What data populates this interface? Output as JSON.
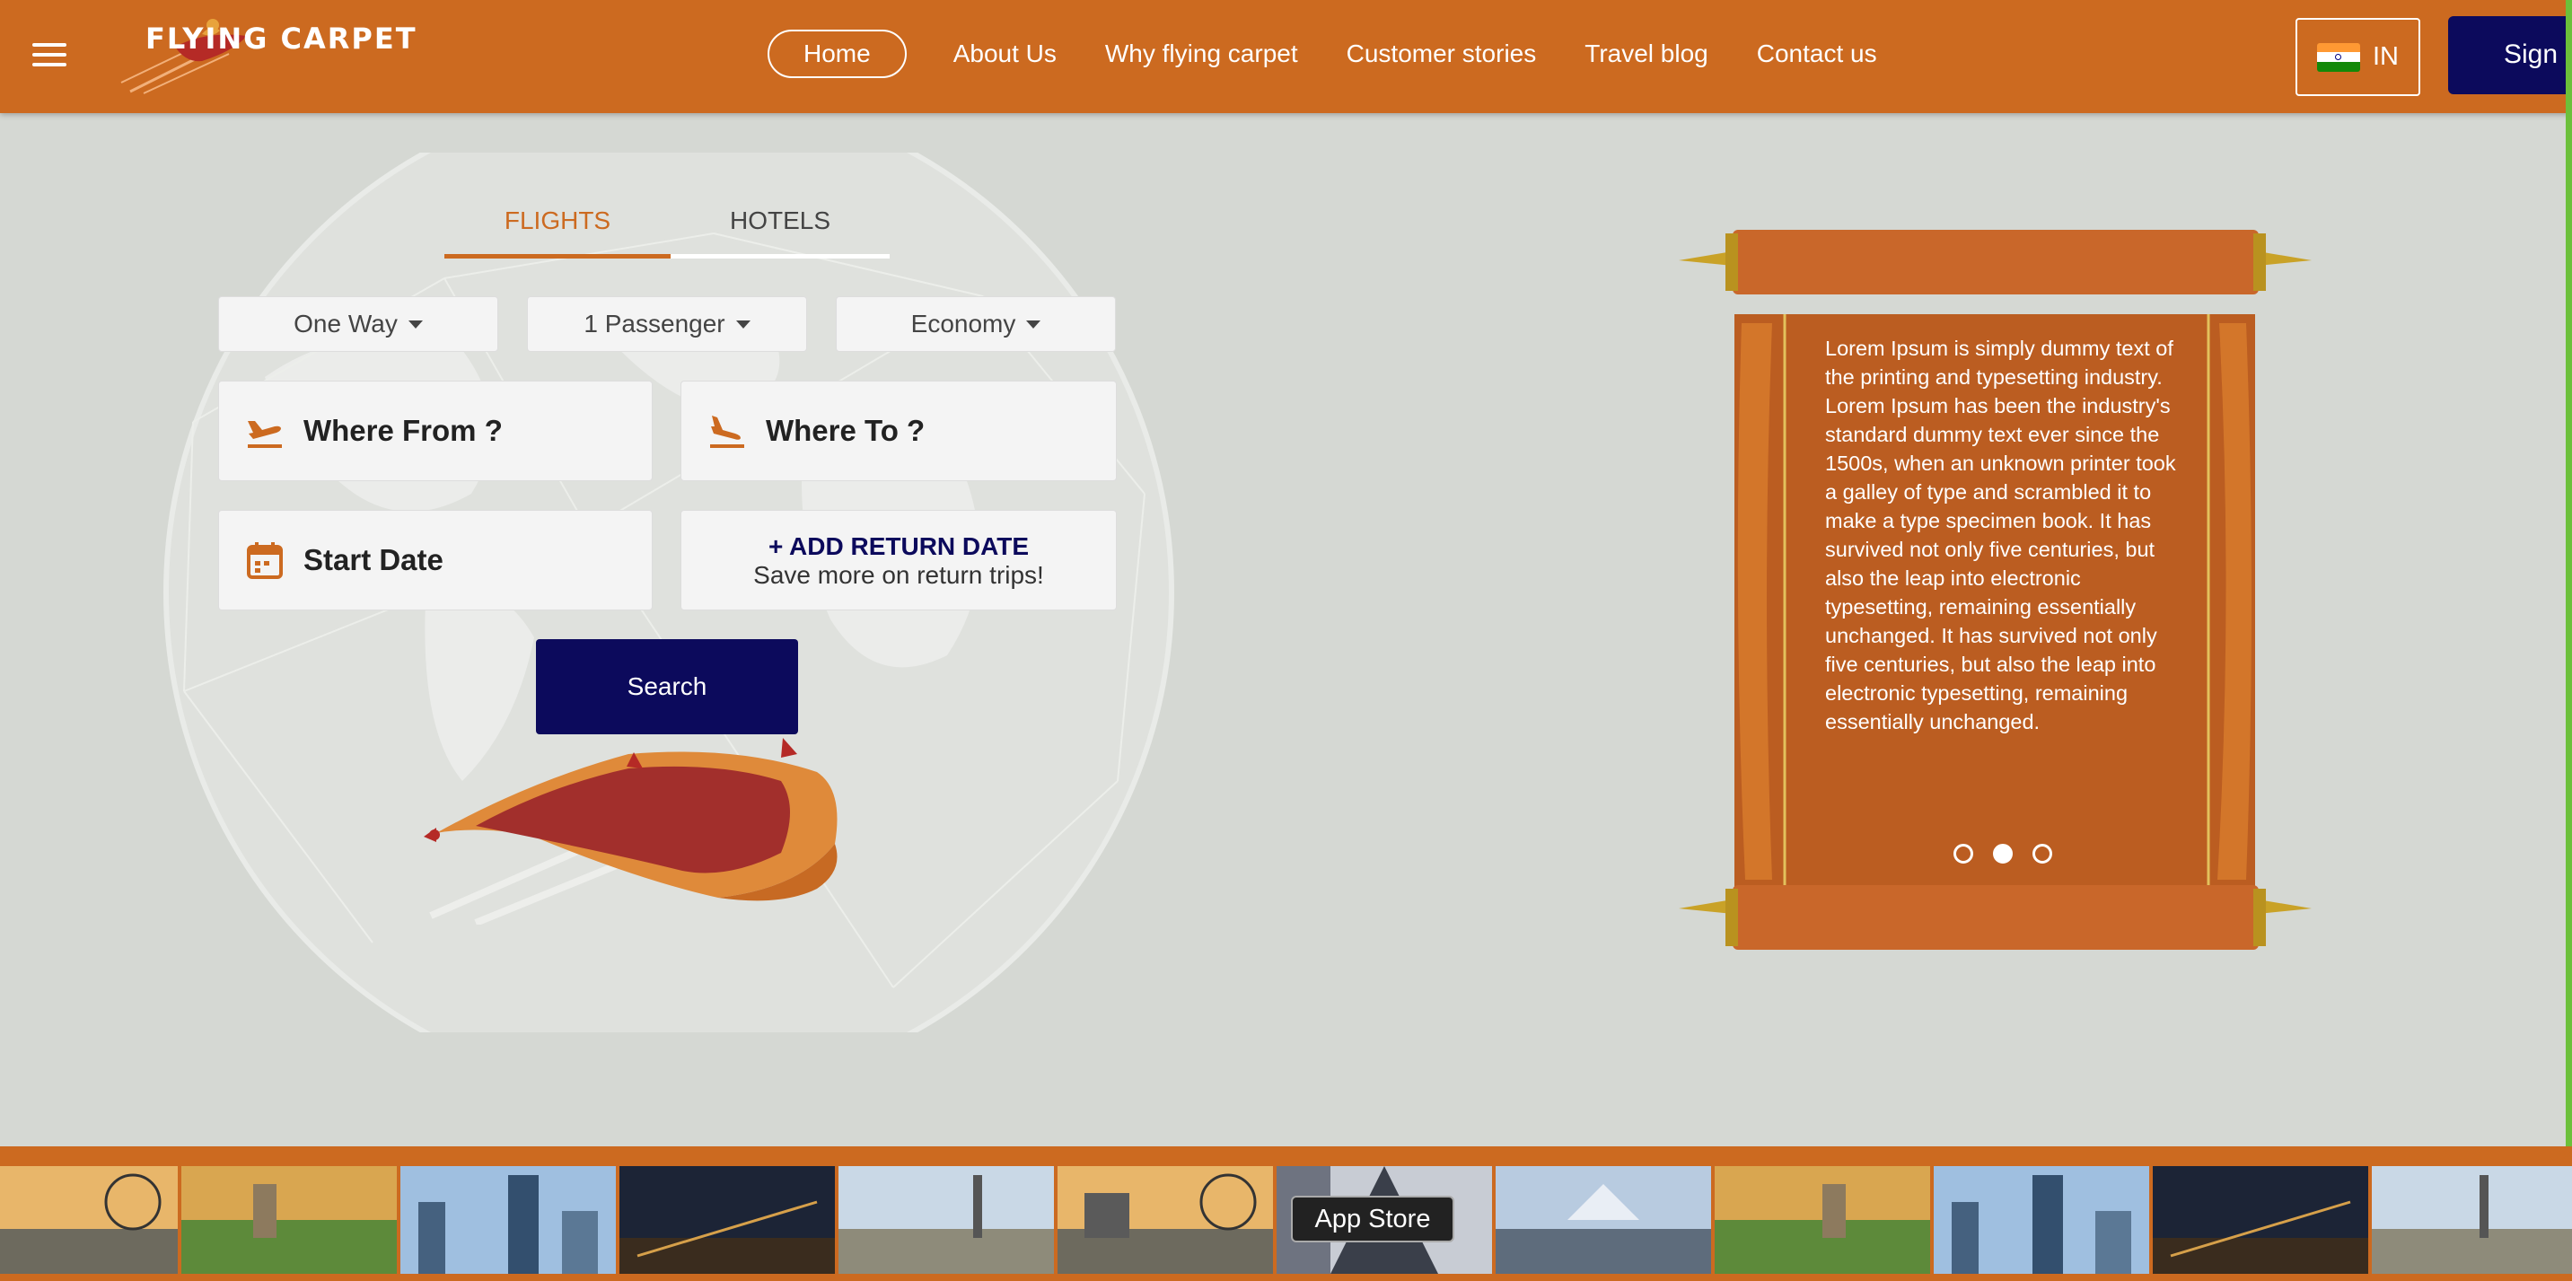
{
  "header": {
    "logo_text": "FLYING CARPET",
    "nav": [
      "Home",
      "About Us",
      "Why flying carpet",
      "Customer stories",
      "Travel blog",
      "Contact us"
    ],
    "active_nav": "Home",
    "country_code": "IN",
    "signin_label": "Sign i"
  },
  "search": {
    "tabs": [
      "FLIGHTS",
      "HOTELS"
    ],
    "active_tab": "FLIGHTS",
    "trip_type": "One Way",
    "passengers": "1 Passenger",
    "cabin_class": "Economy",
    "from_placeholder": "Where From ?",
    "to_placeholder": "Where To ?",
    "start_date_placeholder": "Start Date",
    "return_title": "+ ADD RETURN DATE",
    "return_subtitle": "Save more on return trips!",
    "search_label": "Search"
  },
  "testimonial": {
    "text": "Lorem Ipsum is simply dummy text of the printing and typesetting industry. Lorem Ipsum has been the industry's standard dummy text ever since the 1500s, when an unknown printer took a galley of type and scrambled it to make a type specimen book. It has survived not only five centuries, but also the leap into electronic typesetting, remaining essentially unchanged. It has survived not only five centuries, but also the leap into electronic typesetting, remaining essentially unchanged.",
    "slide_count": 3,
    "active_slide": 2
  },
  "footer_strip": {
    "tooltip": "App Store"
  },
  "colors": {
    "brand_orange": "#cc6a20",
    "navy": "#0c0a5c",
    "page_bg": "#d5d8d3"
  }
}
